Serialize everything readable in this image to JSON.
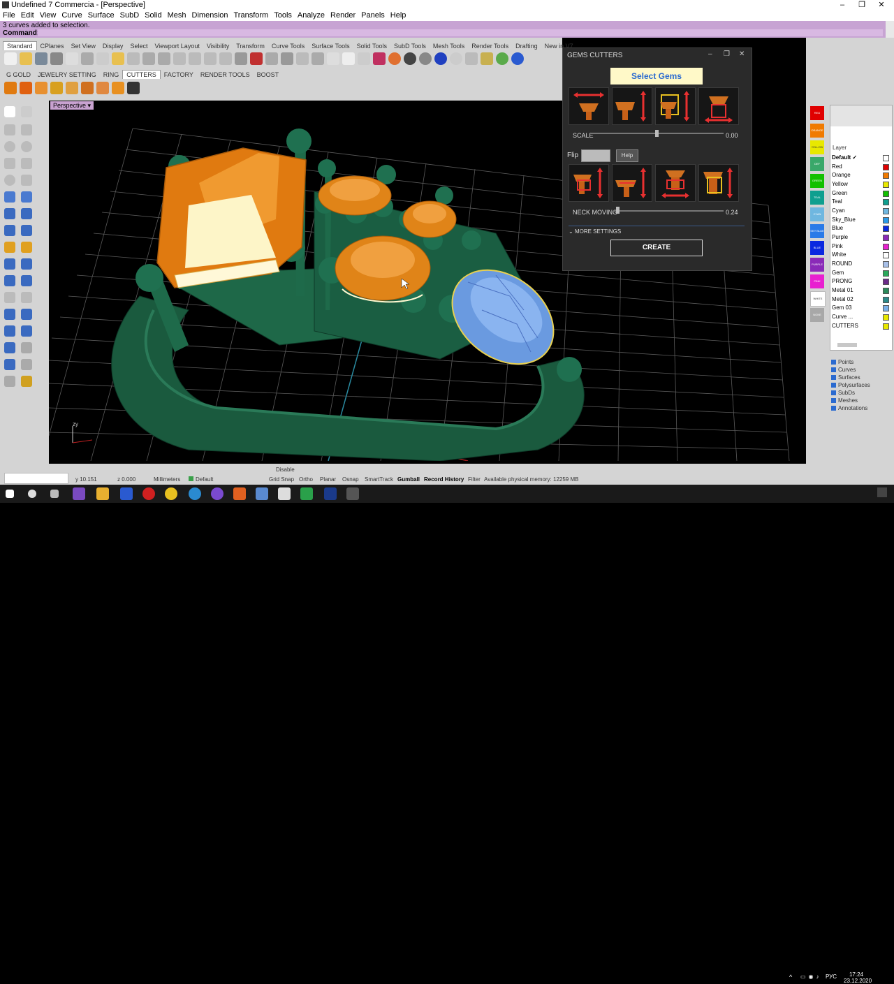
{
  "window": {
    "title": "Undefined 7 Commercia - [Perspective]",
    "min": "–",
    "restore": "❐",
    "close": "✕"
  },
  "menu": [
    "File",
    "Edit",
    "View",
    "Curve",
    "Surface",
    "SubD",
    "Solid",
    "Mesh",
    "Dimension",
    "Transform",
    "Tools",
    "Analyze",
    "Render",
    "Panels",
    "Help"
  ],
  "command": {
    "history": "3 curves added to selection.",
    "prompt_label": "Command:"
  },
  "toolbar_tabs": [
    "Standard",
    "CPlanes",
    "Set View",
    "Display",
    "Select",
    "Viewport Layout",
    "Visibility",
    "Transform",
    "Curve Tools",
    "Surface Tools",
    "Solid Tools",
    "SubD Tools",
    "Mesh Tools",
    "Render Tools",
    "Drafting",
    "New in V7"
  ],
  "plugin_tabs": [
    "G GOLD",
    "JEWELRY SETTING",
    "RING",
    "CUTTERS",
    "FACTORY",
    "RENDER TOOLS",
    "BOOST"
  ],
  "viewport": {
    "label": "Perspective ▾",
    "axis_label": "zy"
  },
  "gems_dialog": {
    "title": "GEMS CUTTERS",
    "select_button": "Select Gems",
    "scale_label": "SCALE",
    "scale_value": "0.00",
    "flip_label": "Flip",
    "help_button": "Help",
    "neck_label": "NECK MOVING",
    "neck_value": "0.24",
    "more_settings": "MORE SETTINGS",
    "create_button": "CREATE"
  },
  "color_buttons": [
    {
      "label": "RED",
      "color": "#e00000"
    },
    {
      "label": "ORANGE",
      "color": "#f07a00"
    },
    {
      "label": "YELLOW",
      "color": "#e8e800"
    },
    {
      "label": "DEF",
      "color": "#39a86a"
    },
    {
      "label": "GREEN",
      "color": "#12c000"
    },
    {
      "label": "TEAL",
      "color": "#0f9f8f"
    },
    {
      "label": "CYAN",
      "color": "#6fb7e0"
    },
    {
      "label": "SKY BLUE",
      "color": "#2a7ae8"
    },
    {
      "label": "BLUE",
      "color": "#0a28e0"
    },
    {
      "label": "PURPLE",
      "color": "#8a2ab8"
    },
    {
      "label": "PINK",
      "color": "#e820d0"
    },
    {
      "label": "WHITE",
      "color": "#ffffff"
    },
    {
      "label": "NONE",
      "color": "#a8a8a8"
    }
  ],
  "layers": {
    "header": "Layer",
    "rows": [
      {
        "name": "Default",
        "color": "#ffffff",
        "current": "✓"
      },
      {
        "name": "Red",
        "color": "#e00000"
      },
      {
        "name": "Orange",
        "color": "#f07a00"
      },
      {
        "name": "Yellow",
        "color": "#e8e800"
      },
      {
        "name": "Green",
        "color": "#12c000"
      },
      {
        "name": "Teal",
        "color": "#0f9f8f"
      },
      {
        "name": "Cyan",
        "color": "#6fb7e0"
      },
      {
        "name": "Sky_Blue",
        "color": "#2a9ae8"
      },
      {
        "name": "Blue",
        "color": "#0a28e0"
      },
      {
        "name": "Purple",
        "color": "#8a2ab8"
      },
      {
        "name": "Pink",
        "color": "#e820d0"
      },
      {
        "name": "White",
        "color": "#ffffff"
      },
      {
        "name": "ROUND",
        "color": "#a8c0e8"
      },
      {
        "name": "Gem",
        "color": "#2aa85a"
      },
      {
        "name": "PRONG",
        "color": "#6a2a88"
      },
      {
        "name": "Metal 01",
        "color": "#2a8a5a"
      },
      {
        "name": "Metal 02",
        "color": "#2a8a8a"
      },
      {
        "name": "Gem 03",
        "color": "#7ab0e8"
      },
      {
        "name": "Curve ...",
        "color": "#e8e800"
      },
      {
        "name": "CUTTERS",
        "color": "#e8e800"
      }
    ]
  },
  "filters": [
    "Points",
    "Curves",
    "Surfaces",
    "Polysurfaces",
    "SubDs",
    "Meshes",
    "Annotations"
  ],
  "osnaps_disable": "Disable",
  "status": {
    "y": "y 10.151",
    "z": "z 0.000",
    "units": "Millimeters",
    "layer": "Default",
    "toggles": [
      "Grid Snap",
      "Ortho",
      "Planar",
      "Osnap",
      "SmartTrack",
      "Gumball",
      "Record History",
      "Filter"
    ],
    "memory": "Available physical memory: 12259 MB"
  },
  "taskbar": {
    "lang": "РУС",
    "time": "17:24",
    "date": "23.12.2020"
  }
}
